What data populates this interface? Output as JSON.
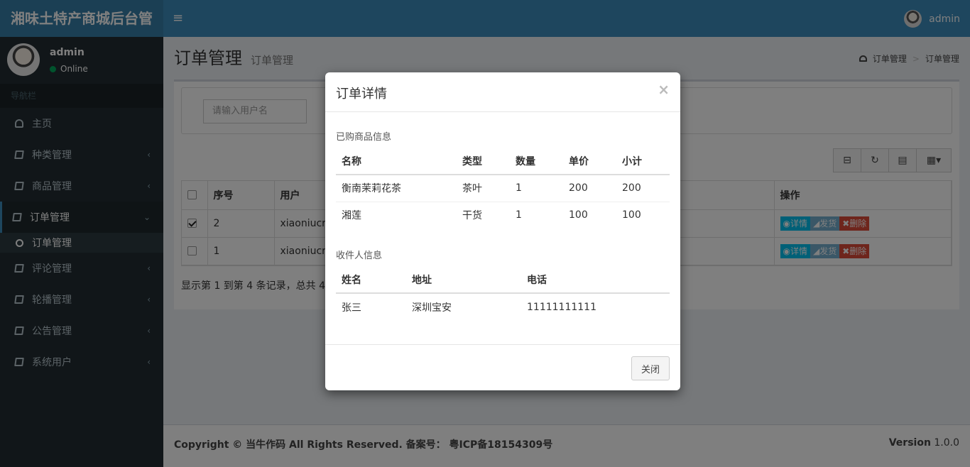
{
  "header": {
    "logo": "湘味土特产商城后台管",
    "menu_icon": "≡",
    "user": "admin"
  },
  "sidebar": {
    "user_name": "admin",
    "status": "Online",
    "nav_header": "导航栏",
    "items": [
      {
        "label": "主页",
        "icon": "dashboard-icon"
      },
      {
        "label": "种类管理",
        "icon": "book-icon"
      },
      {
        "label": "商品管理",
        "icon": "book-icon"
      },
      {
        "label": "订单管理",
        "icon": "book-icon"
      },
      {
        "label": "评论管理",
        "icon": "book-icon"
      },
      {
        "label": "轮播管理",
        "icon": "book-icon"
      },
      {
        "label": "公告管理",
        "icon": "book-icon"
      },
      {
        "label": "系统用户",
        "icon": "book-icon"
      }
    ],
    "sub_item": "订单管理"
  },
  "content": {
    "title": "订单管理",
    "subtitle": "订单管理",
    "breadcrumb": [
      "订单管理",
      "订单管理"
    ],
    "search_placeholder": "请输入用户名",
    "table": {
      "headers": [
        "序号",
        "用户",
        "操作"
      ],
      "rows": [
        {
          "no": "2",
          "user": "xiaoniucr",
          "checked": true
        },
        {
          "no": "1",
          "user": "xiaoniucr",
          "checked": false
        }
      ],
      "actions": {
        "info": "◉详情",
        "ship": "◢发货",
        "del": "✖删除"
      }
    },
    "pager": "显示第 1 到第 4 条记录，总共 4"
  },
  "footer": {
    "copyright": "Copyright © 当牛作码 All Rights Reserved. 备案号： 粤ICP备18154309号",
    "version_label": "Version",
    "version": "1.0.0"
  },
  "modal": {
    "title": "订单详情",
    "close_x": "×",
    "goods_section": "已购商品信息",
    "goods_headers": [
      "名称",
      "类型",
      "数量",
      "单价",
      "小计"
    ],
    "goods_rows": [
      [
        "衡南茉莉花茶",
        "茶叶",
        "1",
        "200",
        "200"
      ],
      [
        "湘莲",
        "干货",
        "1",
        "100",
        "100"
      ]
    ],
    "receiver_section": "收件人信息",
    "receiver_headers": [
      "姓名",
      "地址",
      "电话"
    ],
    "receiver_rows": [
      [
        "张三",
        "深圳宝安",
        "11111111111"
      ]
    ],
    "close_button": "关闭"
  }
}
